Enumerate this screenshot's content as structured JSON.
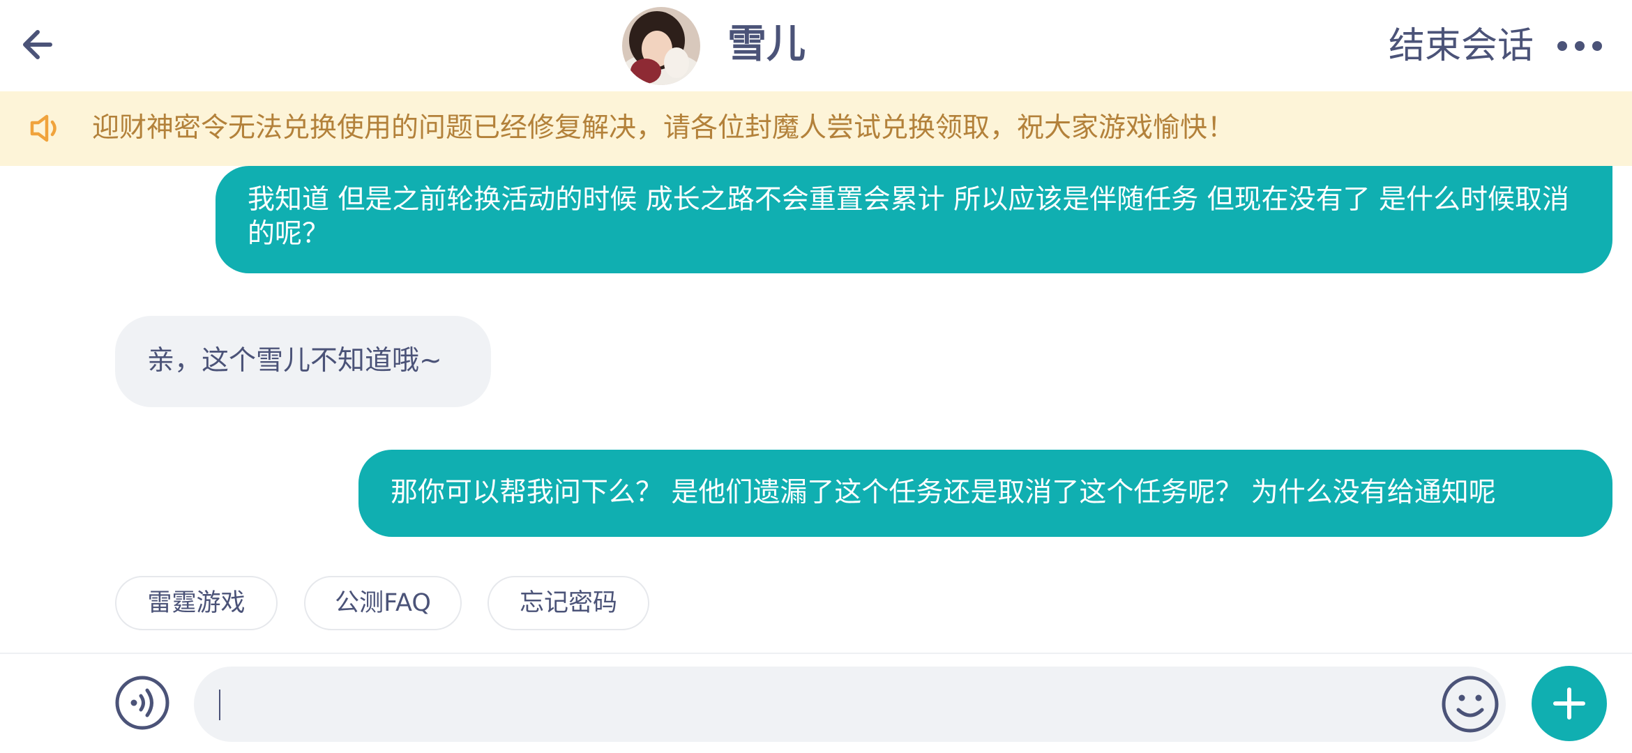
{
  "header": {
    "title": "雪儿",
    "end_session_label": "结束会话"
  },
  "notice": {
    "text": "迎财神密令无法兑换使用的问题已经修复解决，请各位封魔人尝试兑换领取，祝大家游戏愉快！"
  },
  "messages": [
    {
      "from": "user",
      "text": "我知道 但是之前轮换活动的时候 成长之路不会重置会累计 所以应该是伴随任务 但现在没有了 是什么时候取消的呢？"
    },
    {
      "from": "agent",
      "text": "亲，这个雪儿不知道哦~"
    },
    {
      "from": "user",
      "text": "那你可以帮我问下么？ 是他们遗漏了这个任务还是取消了这个任务呢？ 为什么没有给通知呢"
    }
  ],
  "quick_replies": [
    "雷霆游戏",
    "公测FAQ",
    "忘记密码"
  ],
  "input": {
    "value": "",
    "placeholder": ""
  },
  "colors": {
    "accent": "#10afb1",
    "text_primary": "#4b5378",
    "notice_bg": "#fdf4d8",
    "notice_text": "#b3813a",
    "notice_icon": "#f0a33c",
    "bubble_in_bg": "#f0f2f5"
  },
  "icons": [
    "back-arrow-icon",
    "more-icon",
    "speaker-icon",
    "voice-icon",
    "emoji-icon",
    "plus-icon"
  ]
}
